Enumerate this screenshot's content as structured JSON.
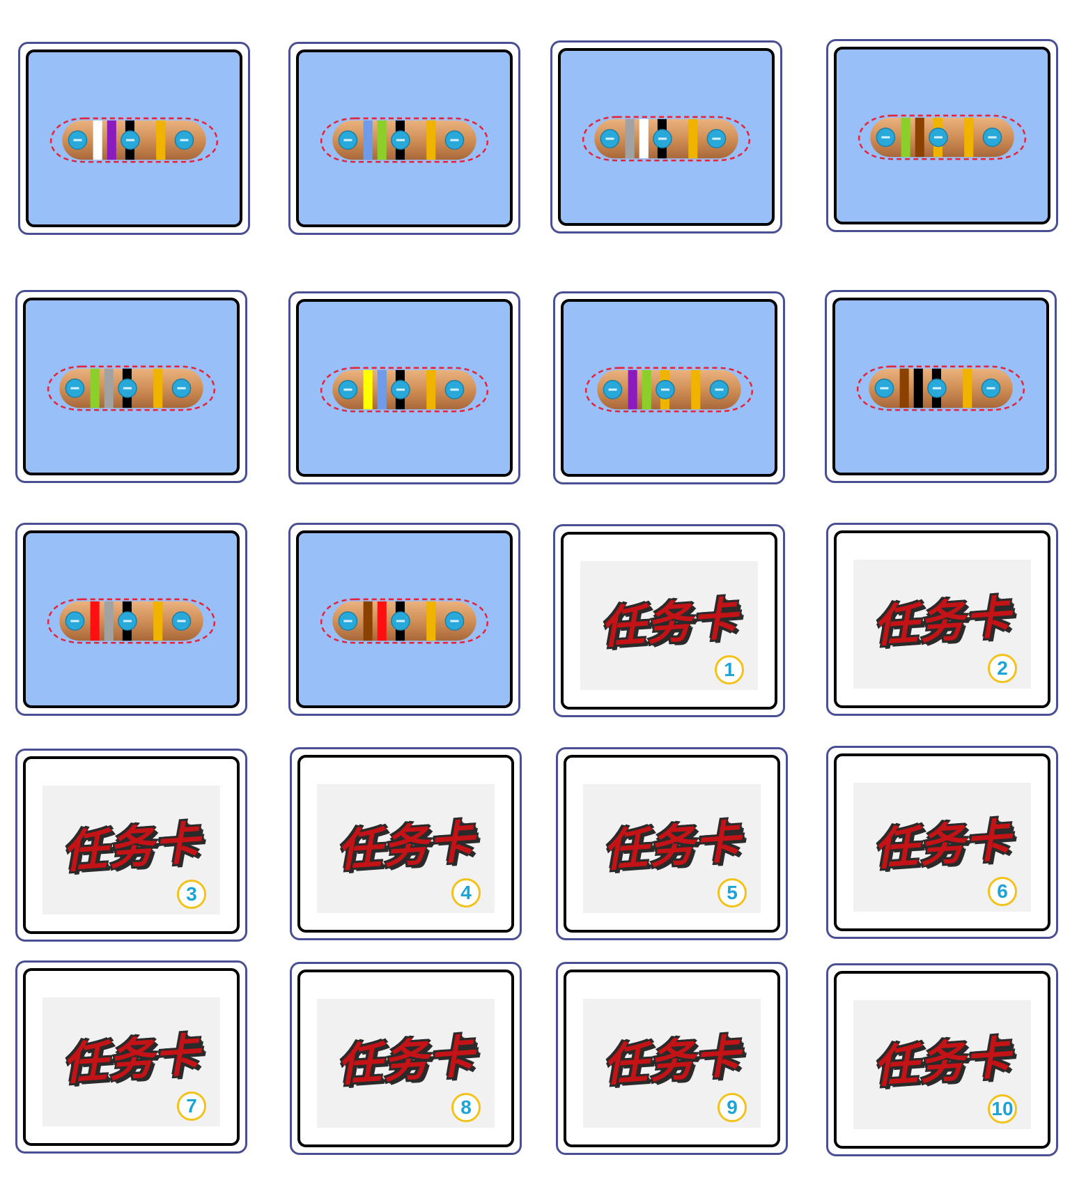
{
  "colors": {
    "card_border": "#4a4f93",
    "card_bg_blue": "#99bff9",
    "resistor_body": "#d18f56",
    "terminal": "#29a9d9",
    "dash_outline": "#e3243b",
    "task_title": "#c41316",
    "number_ring": "#f3c21a",
    "number_text": "#1da3d6"
  },
  "band_colors": {
    "white": "#ffffff",
    "purple": "#8b1bbf",
    "black": "#000000",
    "gold": "#efb300",
    "blue": "#6f9be8",
    "green": "#8ccf2a",
    "gray": "#a2a2a2",
    "brown": "#8b4200",
    "yellow": "#ffff00",
    "red": "#ff1010"
  },
  "resistor_cards": [
    {
      "bands": [
        "white",
        "purple",
        "black",
        "gold"
      ]
    },
    {
      "bands": [
        "blue",
        "green",
        "black",
        "gold"
      ]
    },
    {
      "bands": [
        "gray",
        "white",
        "black",
        "gold"
      ]
    },
    {
      "bands": [
        "green",
        "brown",
        "gold",
        "gold"
      ]
    },
    {
      "bands": [
        "green",
        "gray",
        "black",
        "gold"
      ]
    },
    {
      "bands": [
        "yellow",
        "blue",
        "black",
        "gold"
      ]
    },
    {
      "bands": [
        "purple",
        "green",
        "gold",
        "gold"
      ]
    },
    {
      "bands": [
        "brown",
        "black",
        "black",
        "gold"
      ]
    },
    {
      "bands": [
        "red",
        "gray",
        "black",
        "gold"
      ]
    },
    {
      "bands": [
        "brown",
        "red",
        "black",
        "gold"
      ]
    }
  ],
  "task_cards": [
    {
      "title": "任务卡",
      "number": "1"
    },
    {
      "title": "任务卡",
      "number": "2"
    },
    {
      "title": "任务卡",
      "number": "3"
    },
    {
      "title": "任务卡",
      "number": "4"
    },
    {
      "title": "任务卡",
      "number": "5"
    },
    {
      "title": "任务卡",
      "number": "6"
    },
    {
      "title": "任务卡",
      "number": "7"
    },
    {
      "title": "任务卡",
      "number": "8"
    },
    {
      "title": "任务卡",
      "number": "9"
    },
    {
      "title": "任务卡",
      "number": "10"
    }
  ]
}
